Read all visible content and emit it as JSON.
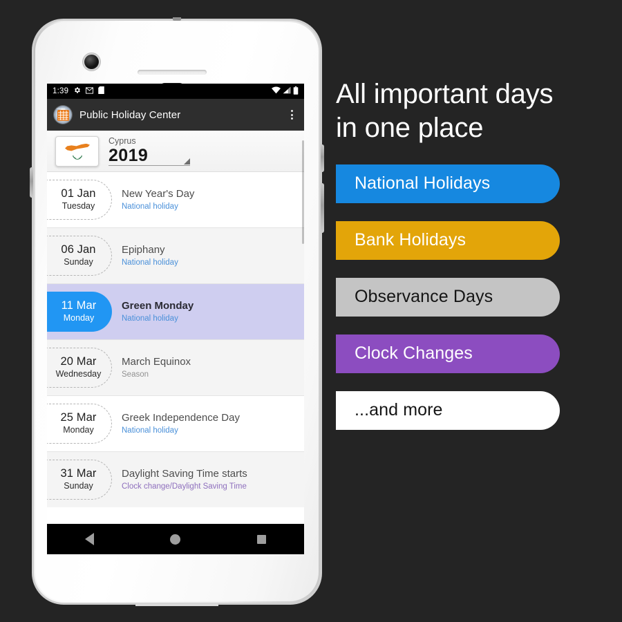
{
  "phone": {
    "status_bar": {
      "time": "1:39",
      "left_icons": [
        "gear-icon",
        "mail-icon",
        "sdcard-icon"
      ],
      "right_icons": [
        "wifi-icon",
        "signal-icon",
        "battery-icon"
      ]
    },
    "app_bar": {
      "title": "Public Holiday Center",
      "icon": "calendar-app-icon",
      "icon_label": "HOLIDAY",
      "overflow": "overflow-menu-icon"
    },
    "country_header": {
      "flag": "cyprus-flag",
      "country": "Cyprus",
      "year": "2019",
      "dropdown_icon": "spinner-arrow-icon"
    },
    "holidays": [
      {
        "date": "01 Jan",
        "weekday": "Tuesday",
        "name": "New Year's Day",
        "type": "National holiday",
        "type_class": "type-national",
        "row_class": "plain",
        "selected": false
      },
      {
        "date": "06 Jan",
        "weekday": "Sunday",
        "name": "Epiphany",
        "type": "National holiday",
        "type_class": "type-national",
        "row_class": "alt",
        "selected": false
      },
      {
        "date": "11 Mar",
        "weekday": "Monday",
        "name": "Green Monday",
        "type": "National holiday",
        "type_class": "type-national",
        "row_class": "highlight",
        "selected": true
      },
      {
        "date": "20 Mar",
        "weekday": "Wednesday",
        "name": "March Equinox",
        "type": "Season",
        "type_class": "type-season",
        "row_class": "alt",
        "selected": false
      },
      {
        "date": "25 Mar",
        "weekday": "Monday",
        "name": "Greek Independence Day",
        "type": "National holiday",
        "type_class": "type-national",
        "row_class": "plain",
        "selected": false
      },
      {
        "date": "31 Mar",
        "weekday": "Sunday",
        "name": "Daylight Saving Time starts",
        "type": "Clock change/Daylight Saving Time",
        "type_class": "type-clock",
        "row_class": "alt",
        "selected": false
      }
    ],
    "nav_bar": {
      "back": "back-icon",
      "home": "home-icon",
      "recents": "recents-icon"
    }
  },
  "promo": {
    "headline": "All important days\nin one place",
    "pills": [
      {
        "label": "National Holidays",
        "class": "p-national",
        "color": "#1688e0"
      },
      {
        "label": "Bank Holidays",
        "class": "p-bank",
        "color": "#e3a509"
      },
      {
        "label": "Observance Days",
        "class": "p-observance",
        "color": "#c4c4c4"
      },
      {
        "label": "Clock Changes",
        "class": "p-clock",
        "color": "#8c4dc0"
      },
      {
        "label": "...and more",
        "class": "p-more",
        "color": "#ffffff"
      }
    ]
  },
  "theme": {
    "background": "#242424",
    "accent_blue": "#2196f3",
    "highlight_row": "#cfcef0"
  }
}
